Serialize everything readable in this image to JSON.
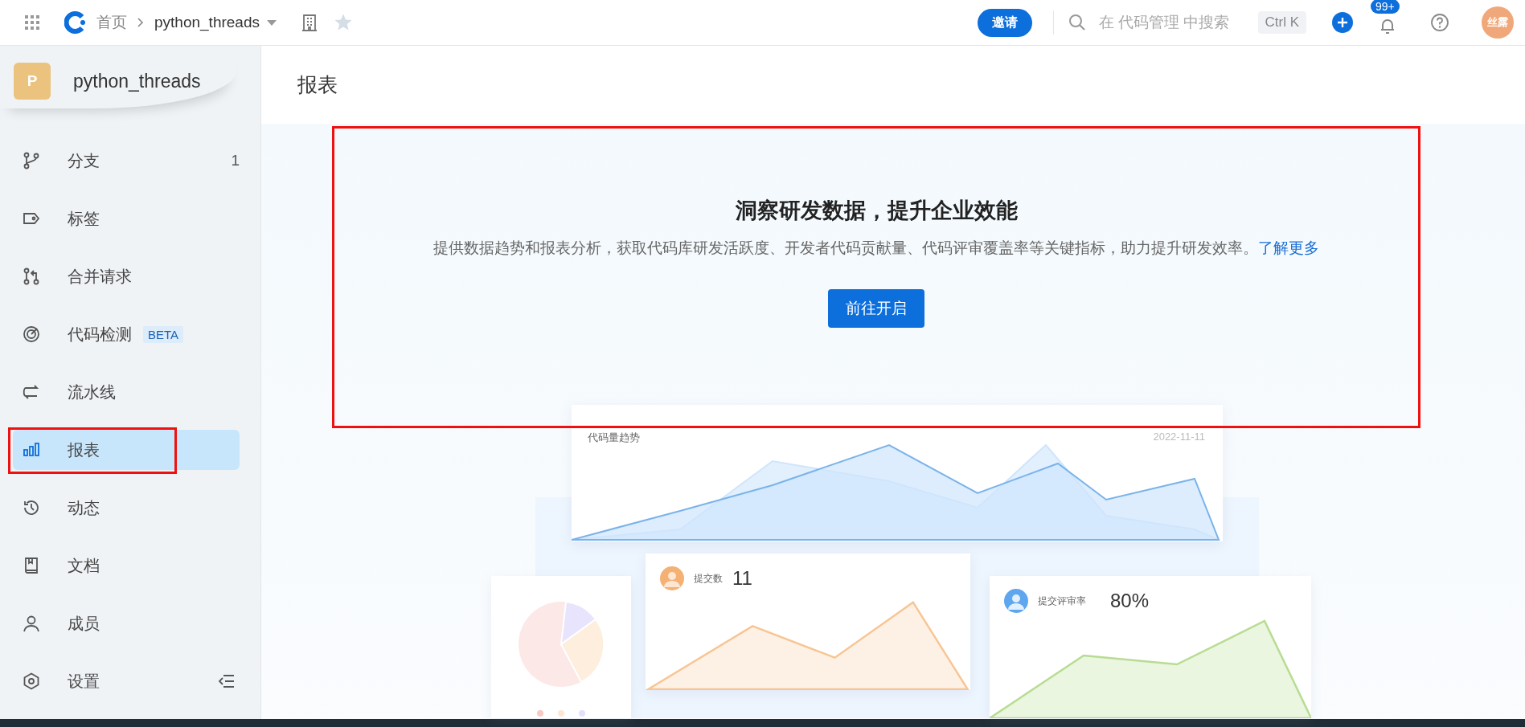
{
  "topbar": {
    "breadcrumb": [
      {
        "label": "首页"
      },
      {
        "label": "python_threads"
      }
    ],
    "invite_button": "邀请",
    "search": {
      "placeholder": "在 代码管理 中搜索",
      "shortcut": "Ctrl K"
    },
    "notifications_badge": "99+",
    "user_avatar": "丝露"
  },
  "sidebar": {
    "project": {
      "initial": "P",
      "name": "python_threads"
    },
    "items": [
      {
        "label": "分支",
        "count": "1",
        "selected": false
      },
      {
        "label": "标签",
        "selected": false
      },
      {
        "label": "合并请求",
        "selected": false
      },
      {
        "label": "代码检测",
        "badge": "BETA",
        "selected": false
      },
      {
        "label": "流水线",
        "selected": false
      },
      {
        "label": "报表",
        "selected": true
      },
      {
        "label": "动态",
        "selected": false
      },
      {
        "label": "文档",
        "selected": false
      },
      {
        "label": "成员",
        "selected": false
      },
      {
        "label": "设置",
        "selected": false
      }
    ]
  },
  "page": {
    "title": "报表",
    "banner": {
      "title": "洞察研发数据，提升企业效能",
      "description": "提供数据趋势和报表分析，获取代码库研发活跃度、开发者代码贡献量、代码评审覆盖率等关键指标，助力提升研发效率。",
      "link": "了解更多",
      "button": "前往开启"
    },
    "illustration": {
      "trend_card": {
        "title": "代码量趋势",
        "date": "2022-11-11"
      },
      "commit_card": {
        "label": "提交数",
        "value": "11"
      },
      "review_card": {
        "label": "提交评审率",
        "value": "80%"
      }
    }
  }
}
